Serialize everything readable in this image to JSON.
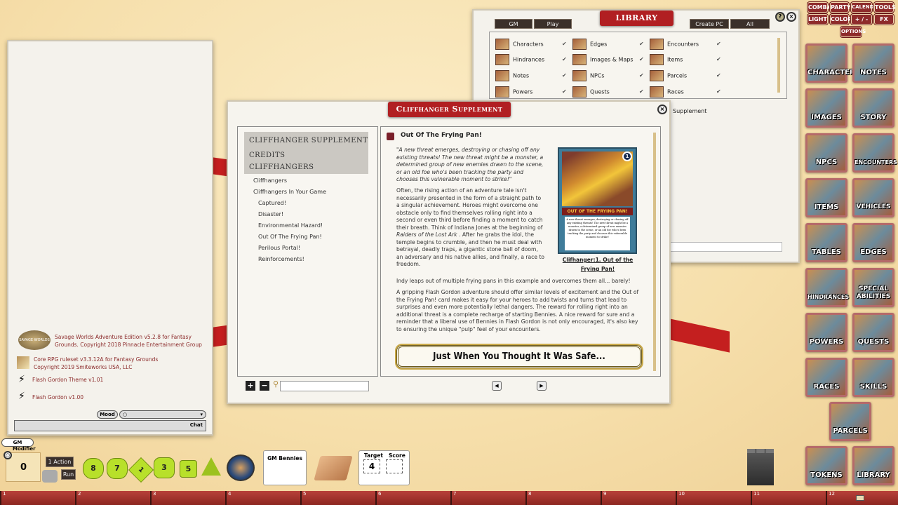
{
  "top_buttons": [
    "COMBAT",
    "PARTY",
    "CALENDAR",
    "TOOLS",
    "LIGHT",
    "COLOR",
    "+ / -",
    "FX",
    "OPTIONS"
  ],
  "sidebar": [
    "CHARACTERS",
    "NOTES",
    "IMAGES",
    "STORY",
    "NPCS",
    "ENCOUNTERS",
    "ITEMS",
    "VEHICLES",
    "TABLES",
    "EDGES",
    "HINDRANCES",
    "SPECIAL ABILITIES",
    "POWERS",
    "QUESTS",
    "RACES",
    "SKILLS",
    "PARCELS",
    "TOKENS",
    "LIBRARY"
  ],
  "library": {
    "title": "Library",
    "tabs": [
      "GM",
      "Play",
      "Create PC",
      "All"
    ],
    "help": "?",
    "items": [
      "Characters",
      "Edges",
      "Encounters",
      "Hindrances",
      "Images & Maps",
      "Items",
      "Notes",
      "NPCs",
      "Parcels",
      "Powers",
      "Quests",
      "Races"
    ],
    "check": "✔",
    "module_name": "Supplement"
  },
  "chat": {
    "entries": [
      {
        "text": "Savage Worlds Adventure Edition v5.2.8 for Fantasy Grounds. Copyright 2018 Pinnacle Entertainment Group",
        "logo": "SAVAGE WORLDS"
      },
      {
        "text": "Core RPG ruleset v3.3.12A for Fantasy Grounds Copyright 2019 Smiteworks USA, LLC"
      },
      {
        "text": "Flash Gordon Theme v1.01"
      },
      {
        "text": "Flash Gordon v1.00"
      }
    ],
    "mood_label": "Mood",
    "chat_button": "Chat"
  },
  "book": {
    "title": "Cliffhanger Supplement",
    "toc_headers": [
      "Cliffhanger Supplement",
      "Credits",
      "Cliffhangers"
    ],
    "toc_items": [
      "Cliffhangers",
      "Cliffhangers In Your Game"
    ],
    "toc_subitems": [
      "Captured!",
      "Disaster!",
      "Environmental Hazard!",
      "Out Of The Frying Pan!",
      "Perilous Portal!",
      "Reinforcements!"
    ],
    "page_title": "Out Of The Frying Pan!",
    "quote": "\"A new threat emerges, destroying or chasing off any existing threats! The new threat might be a monster, a determined group of new enemies drawn to the scene, or an old foe who's been tracking the party and chooses this vulnerable moment to strike!\"",
    "para1": "Often, the rising action of an adventure tale isn't necessarily presented in the form of a straight path to a singular achievement. Heroes might overcome one obstacle only to find themselves rolling right into a second or even third before finding a moment to catch their breath. Think of Indiana Jones at the beginning of",
    "para1_italic": "Raiders of the Lost Ark",
    "para1_end": ". After he grabs the idol, the temple begins to crumble, and then he must deal with betrayal, deadly traps, a gigantic stone ball of doom, an adversary and his native allies, and finally, a race to freedom.",
    "para2": "Indy leaps out of multiple frying pans in this example and overcomes them all... barely!",
    "para3": "A gripping Flash Gordon adventure should offer similar levels of excitement and the Out of the Frying Pan! card makes it easy for your heroes to add twists and turns that lead to surprises and even more potentially lethal dangers. The reward for rolling right into an additional threat is a complete recharge of starting Bennies. A nice reward for sure and a reminder that a liberal use of Bennies in Flash Gordon is not only encouraged, it's also key to ensuring the unique \"pulp\" feel of your encounters.",
    "card_title": "OUT OF THE FRYING PAN!",
    "card_number": "1",
    "card_text": "A new threat emerges, destroying or chasing off any existing threats! The new threat might be a monster, a determined group of new enemies drawn to the scene, or an old foe who's been tracking the party and chooses this vulnerable moment to strike!",
    "card_caption": "Clifhanger:1. Out of the Frying Pan!",
    "banner": "Just When You Thought It Was Safe..."
  },
  "toolbar": {
    "gm_label": "GM",
    "modifier_label": "Modifier",
    "modifier_value": "0",
    "action_label": "1 Action",
    "run_label": "Run",
    "dice": [
      "8",
      "7",
      "1",
      "3",
      "5",
      "4"
    ],
    "bennies_label": "GM Bennies",
    "target_label": "Target",
    "score_label": "Score",
    "target_value": "4"
  },
  "hotkeys": [
    "1",
    "2",
    "3",
    "4",
    "5",
    "6",
    "7",
    "8",
    "9",
    "10",
    "11",
    "12"
  ]
}
